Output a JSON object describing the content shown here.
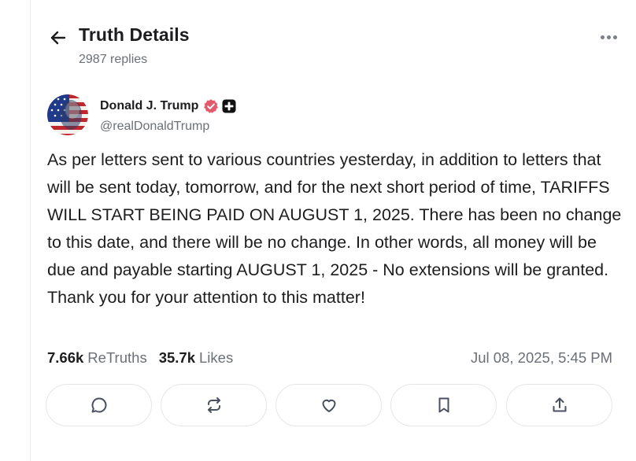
{
  "header": {
    "title": "Truth Details",
    "replies": "2987 replies",
    "back_icon": "arrow-left-icon",
    "more_icon": "more-horizontal-icon"
  },
  "post": {
    "author": {
      "name": "Donald J. Trump",
      "handle": "@realDonaldTrump",
      "verified_badge_color": "#e35a6c",
      "plus_badge_color": "#111111"
    },
    "text": "As per letters sent to various countries yesterday, in addition to letters that will be sent today, tomorrow, and for the next short period of time, TARIFFS WILL START BEING PAID ON AUGUST 1, 2025. There has been no change to this date, and there will be no change. In other words, all money will be due and payable starting AUGUST 1, 2025 - No extensions will be granted. Thank you for your attention to this matter!",
    "stats": {
      "retruths_count": "7.66k",
      "retruths_label": "ReTruths",
      "likes_count": "35.7k",
      "likes_label": "Likes"
    },
    "timestamp": "Jul 08, 2025, 5:45 PM"
  },
  "actions": [
    {
      "icon": "reply-icon"
    },
    {
      "icon": "retruth-icon"
    },
    {
      "icon": "like-icon"
    },
    {
      "icon": "bookmark-icon"
    },
    {
      "icon": "share-icon"
    }
  ],
  "colors": {
    "text": "#1d1d1f",
    "muted": "#6b6f76",
    "border": "#e4e6ea",
    "icon": "#4a5060"
  }
}
